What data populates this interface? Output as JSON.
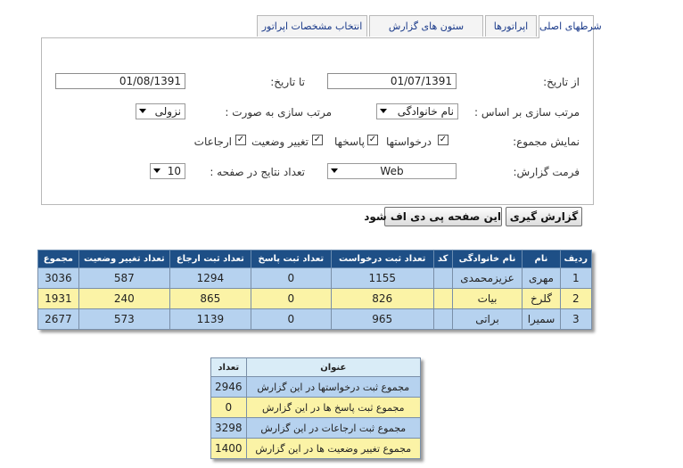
{
  "tabs": [
    {
      "label": "شرطهای اصلی",
      "active": true
    },
    {
      "label": "اپراتورها",
      "active": false
    },
    {
      "label": "ستون های گزارش",
      "active": false
    },
    {
      "label": "انتخاب مشخصات اپراتور",
      "active": false
    }
  ],
  "form": {
    "from_date_label": "از تاریخ:",
    "from_date_value": "01/07/1391",
    "to_date_label": "تا تاریخ:",
    "to_date_value": "01/08/1391",
    "sort_by_label": "مرتب سازی بر اساس :",
    "sort_by_value": "نام خانوادگی",
    "sort_order_label": "مرتب سازی به صورت :",
    "sort_order_value": "نزولی",
    "show_total_label": "نمایش مجموع:",
    "checkboxes": [
      {
        "label": "درخواستها",
        "checked": true
      },
      {
        "label": "پاسخها",
        "checked": true
      },
      {
        "label": "تغییر وضعیت",
        "checked": true
      },
      {
        "label": "ارجاعات",
        "checked": true
      }
    ],
    "format_label": "فرمت گزارش:",
    "format_value": "Web",
    "per_page_label": "تعداد نتایج در صفحه :",
    "per_page_value": "10"
  },
  "buttons": {
    "report": "گزارش گیری",
    "pdf": "این صفحه پی دی اف شود"
  },
  "results": {
    "headers": [
      "ردیف",
      "نام",
      "نام خانوادگی",
      "کد",
      "تعداد ثبت درخواست",
      "تعداد ثبت پاسخ",
      "تعداد ثبت ارجاع",
      "تعداد تغییر وضعیت",
      "مجموع"
    ],
    "rows": [
      [
        "1",
        "مهری",
        "عزیزمحمدی",
        "",
        "1155",
        "0",
        "1294",
        "587",
        "3036"
      ],
      [
        "2",
        "گلرخ",
        "بیات",
        "",
        "826",
        "0",
        "865",
        "240",
        "1931"
      ],
      [
        "3",
        "سمیرا",
        "براتی",
        "",
        "965",
        "0",
        "1139",
        "573",
        "2677"
      ]
    ]
  },
  "summary": {
    "headers": [
      "عنوان",
      "تعداد"
    ],
    "rows": [
      [
        "مجموع ثبت درخواستها در این گزارش",
        "2946"
      ],
      [
        "مجموع ثبت پاسخ ها در این گزارش",
        "0"
      ],
      [
        "مجموع ثبت ارجاعات در این گزارش",
        "3298"
      ],
      [
        "مجموع تغییر وضعیت ها در این گزارش",
        "1400"
      ]
    ]
  },
  "colors": {
    "header_dark": "#1e4f86",
    "row_blue": "#b6d2ef",
    "row_yellow": "#fbf3a6",
    "summary_header": "#d9ecf7",
    "tab_text": "#1a3a8a"
  }
}
